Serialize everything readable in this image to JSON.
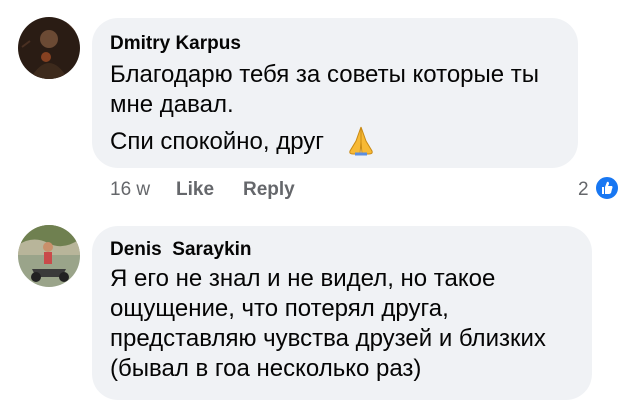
{
  "comments": [
    {
      "author": "Dmitry Karpus",
      "lines": [
        "Благодарю тебя за советы которые ты",
        "мне давал.",
        "Спи спокойно, друг"
      ],
      "emoji_icon": "folded-hands-icon",
      "time": "16 w",
      "like_label": "Like",
      "reply_label": "Reply",
      "reaction_count": "2",
      "reaction_icon": "like-thumb-icon"
    },
    {
      "author": "Denis  Saraykin",
      "lines": [
        "Я его не знал и не видел, но такое",
        "ощущение, что потерял друга,",
        "представляю чувства друзей и близких",
        "(бывал в гоа несколько раз)"
      ]
    }
  ],
  "colors": {
    "bubble": "#f0f2f5",
    "meta": "#65676b",
    "accent": "#1877f2"
  }
}
